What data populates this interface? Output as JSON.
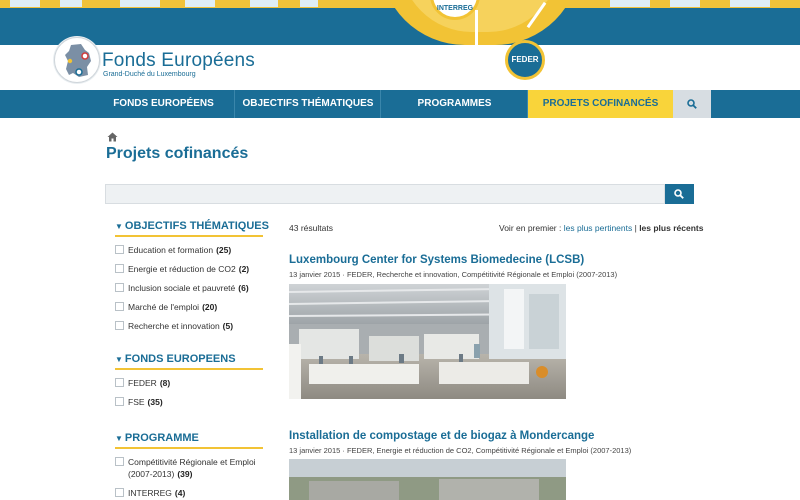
{
  "banner": {
    "interreg_label": "INTERREG",
    "feder_label": "FEDER"
  },
  "brand": {
    "title_part1": "Fonds ",
    "title_initial": "E",
    "title_part2": "uropéens",
    "subtitle": "Grand-Duché du Luxembourg"
  },
  "nav": {
    "items": [
      {
        "label": "FONDS EUROPÉENS"
      },
      {
        "label": "OBJECTIFS THÉMATIQUES"
      },
      {
        "label": "PROGRAMMES"
      },
      {
        "label": "PROJETS COFINANCÉS"
      }
    ],
    "search_icon": "search-icon"
  },
  "page": {
    "title": "Projets cofinancés",
    "home_icon": "home-icon",
    "search_value": ""
  },
  "facets": [
    {
      "heading": "OBJECTIFS THÉMATIQUES",
      "items": [
        {
          "label": "Education et formation",
          "count": "(25)"
        },
        {
          "label": "Energie et réduction de CO2",
          "count": "(2)"
        },
        {
          "label": "Inclusion sociale et pauvreté",
          "count": "(6)"
        },
        {
          "label": "Marché de l'emploi",
          "count": "(20)"
        },
        {
          "label": "Recherche et innovation",
          "count": "(5)"
        }
      ]
    },
    {
      "heading": "FONDS EUROPEENS",
      "items": [
        {
          "label": "FEDER",
          "count": "(8)"
        },
        {
          "label": "FSE",
          "count": "(35)"
        }
      ]
    },
    {
      "heading": "PROGRAMME",
      "items": [
        {
          "label": "Compétitivité Régionale et Emploi (2007-2013)",
          "count": "(39)"
        },
        {
          "label": "INTERREG",
          "count": "(4)"
        }
      ]
    }
  ],
  "results": {
    "count_text": "43 résultats",
    "sort_prefix": "Voir en premier : ",
    "sort_relevant": "les plus pertinents",
    "sort_separator": " | ",
    "sort_recent": "les plus récents",
    "items": [
      {
        "title": "Luxembourg Center for Systems Biomedecine (LCSB)",
        "meta": "13 janvier 2015  ·  FEDER, Recherche et innovation, Compétitivité Régionale et Emploi (2007-2013)"
      },
      {
        "title": "Installation de compostage et de biogaz à Mondercange",
        "meta": "13 janvier 2015  ·  FEDER, Energie et réduction de CO2, Compétitivité Régionale et Emploi (2007-2013)"
      }
    ]
  },
  "colors": {
    "primary": "#1a6d96",
    "accent": "#f9d43a"
  }
}
